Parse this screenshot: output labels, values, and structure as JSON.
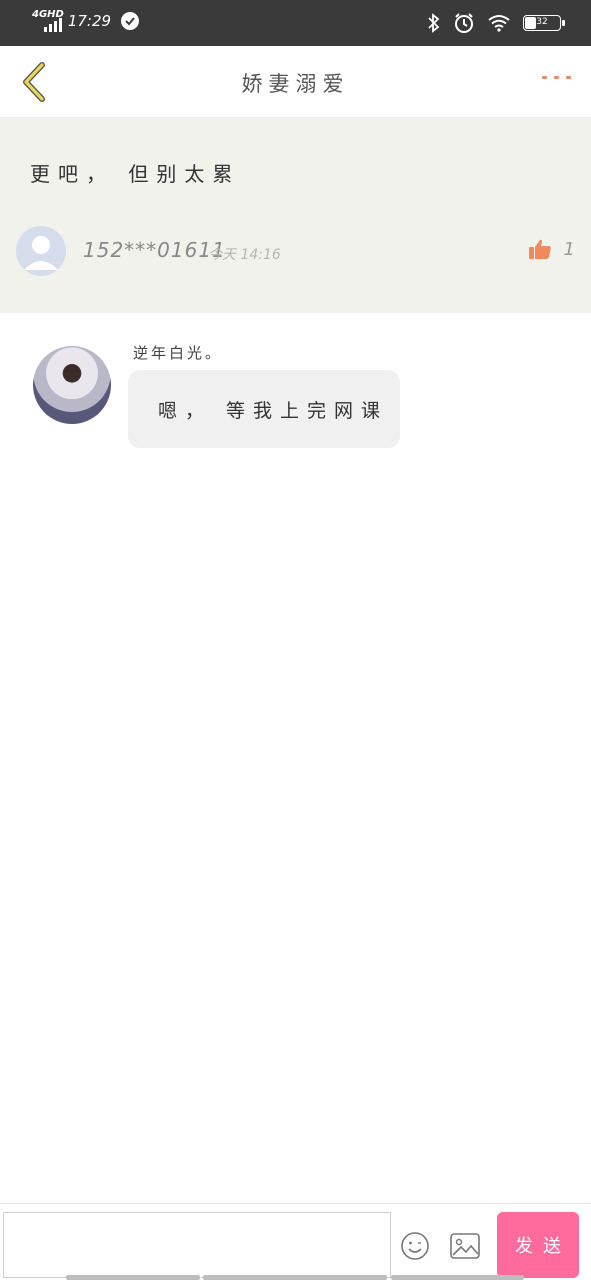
{
  "status_bar": {
    "network": "4GHD",
    "time": "17:29",
    "battery": "32"
  },
  "header": {
    "title": "娇妻溺爱"
  },
  "post": {
    "text": "更吧， 但别太累",
    "username": "152***01611",
    "meta": "今天 14:16",
    "like_count": "1"
  },
  "reply": {
    "name": "逆年白光。",
    "message": "嗯， 等我上完网课"
  },
  "composer": {
    "input_value": "",
    "input_placeholder": "",
    "send_label": "发送"
  },
  "colors": {
    "accent_send": "#ff6b9d",
    "accent_like": "#f08a5d",
    "back_arrow": "#e8d85a",
    "post_background": "#f2f2ed"
  },
  "icons": [
    "back-arrow-icon",
    "more-dots-icon",
    "thumbs-up-icon",
    "emoji-icon",
    "image-icon",
    "bluetooth-icon",
    "alarm-icon",
    "wifi-icon",
    "battery-icon",
    "signal-icon",
    "check-icon"
  ]
}
